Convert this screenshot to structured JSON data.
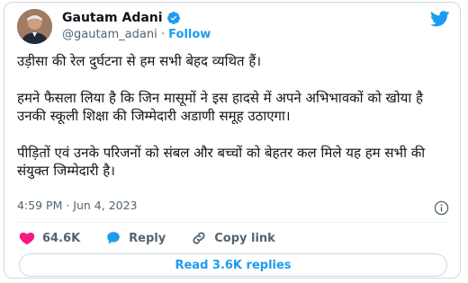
{
  "author": {
    "name": "Gautam Adani",
    "handle": "@gautam_adani",
    "separator": "·",
    "follow_label": "Follow"
  },
  "tweet": {
    "paragraphs": [
      "उड़ीसा की रेल दुर्घटना से हम सभी बेहद व्यथित हैं।",
      "हमने फैसला लिया है कि जिन मासूमों ने इस हादसे में अपने अभिभावकों को खोया है उनकी स्कूली शिक्षा की जिम्मेदारी अडाणी समूह उठाएगा।",
      "पीड़ितों एवं उनके परिजनों को संबल और बच्चों को बेहतर कल मिले यह हम सभी की संयुक्त जिम्मेदारी है।"
    ],
    "timestamp": "4:59 PM · Jun 4, 2023"
  },
  "actions": {
    "likes": "64.6K",
    "reply_label": "Reply",
    "copy_link_label": "Copy link"
  },
  "read_replies_label": "Read 3.6K replies",
  "colors": {
    "accent": "#1d9bf0",
    "like": "#f91880",
    "text": "#0f1419",
    "secondary": "#536471",
    "border": "#cfd9de"
  },
  "icons": [
    "verified-badge-icon",
    "twitter-bird-icon",
    "info-icon",
    "heart-icon",
    "reply-bubble-icon",
    "link-icon"
  ]
}
